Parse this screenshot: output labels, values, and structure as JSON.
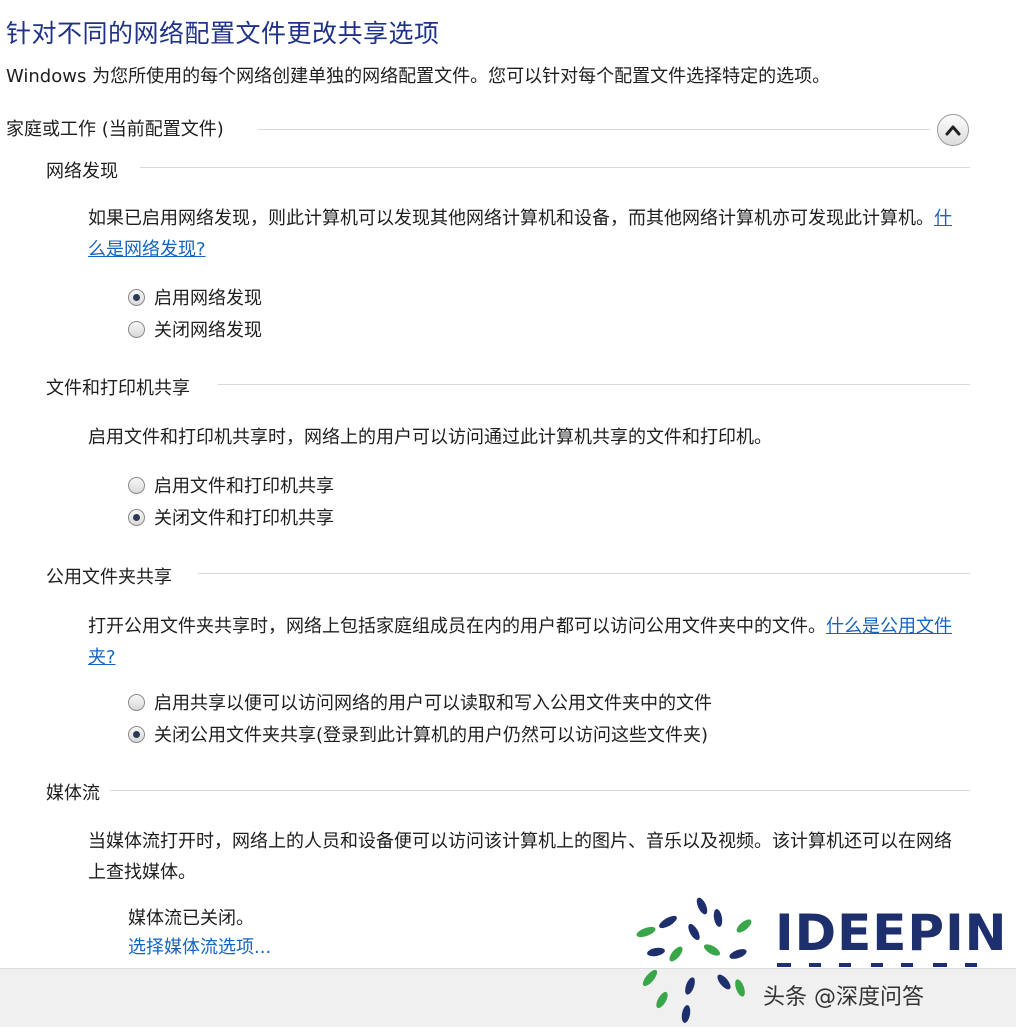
{
  "page": {
    "title": "针对不同的网络配置文件更改共享选项",
    "subtitle": "Windows 为您所使用的每个网络创建单独的网络配置文件。您可以针对每个配置文件选择特定的选项。"
  },
  "profile": {
    "label": "家庭或工作 (当前配置文件)",
    "toggle_icon": "chevron-up-icon",
    "expanded": true
  },
  "network_discovery": {
    "heading": "网络发现",
    "desc": "如果已启用网络发现，则此计算机可以发现其他网络计算机和设备，而其他网络计算机亦可发现此计算机。",
    "link": "什么是网络发现?",
    "options": [
      {
        "label": "启用网络发现",
        "selected": true
      },
      {
        "label": "关闭网络发现",
        "selected": false
      }
    ]
  },
  "file_printer_sharing": {
    "heading": "文件和打印机共享",
    "desc": "启用文件和打印机共享时，网络上的用户可以访问通过此计算机共享的文件和打印机。",
    "options": [
      {
        "label": "启用文件和打印机共享",
        "selected": false
      },
      {
        "label": "关闭文件和打印机共享",
        "selected": true
      }
    ]
  },
  "public_folder_sharing": {
    "heading": "公用文件夹共享",
    "desc": "打开公用文件夹共享时，网络上包括家庭组成员在内的用户都可以访问公用文件夹中的文件。",
    "link": "什么是公用文件夹?",
    "options": [
      {
        "label": "启用共享以便可以访问网络的用户可以读取和写入公用文件夹中的文件",
        "selected": false
      },
      {
        "label": "关闭公用文件夹共享(登录到此计算机的用户仍然可以访问这些文件夹)",
        "selected": true
      }
    ]
  },
  "media_streaming": {
    "heading": "媒体流",
    "desc": "当媒体流打开时，网络上的人员和设备便可以访问该计算机上的图片、音乐以及视频。该计算机还可以在网络上查找媒体。",
    "status": "媒体流已关闭。",
    "link": "选择媒体流选项..."
  },
  "watermark": {
    "brand": "IDEEPIN",
    "handle": "头条 @深度问答"
  },
  "colors": {
    "title": "#1e3287",
    "link": "#1565c0",
    "watermark_brand": "#1d2f6d",
    "watermark_green": "#3aa64a"
  }
}
